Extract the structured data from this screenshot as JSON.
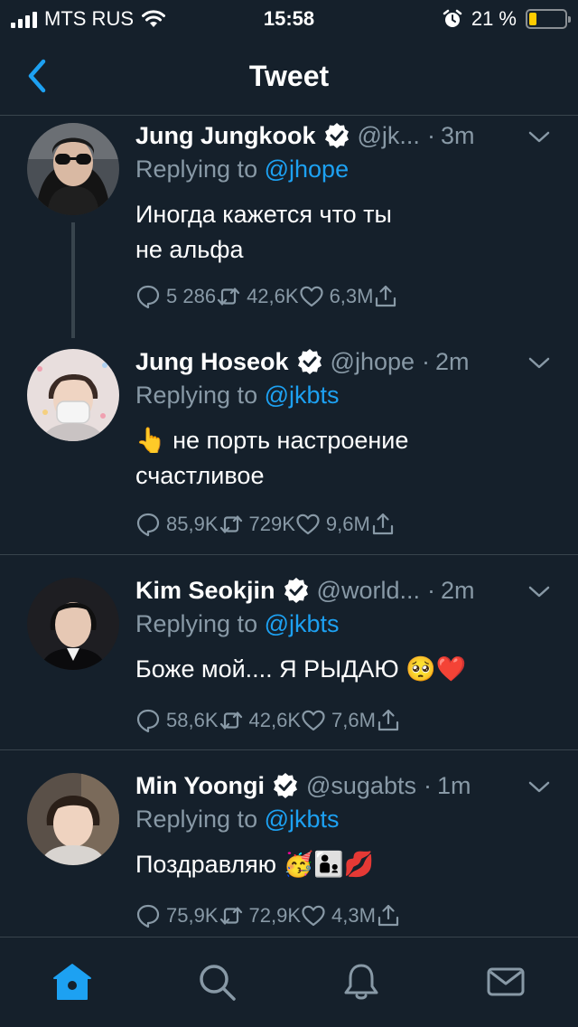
{
  "status_bar": {
    "carrier": "MTS RUS",
    "time": "15:58",
    "battery_percent": "21 %",
    "battery_level": 0.21
  },
  "nav": {
    "title": "Tweet"
  },
  "tweets": [
    {
      "name": "Jung Jungkook",
      "handle": "@jk...",
      "time": "3m",
      "replying_prefix": "Replying to",
      "replying_to": "@jhope",
      "text_lines": [
        "Иногда кажется что ты",
        "не альфа"
      ],
      "replies": "5 286",
      "retweets": "42,6K",
      "likes": "6,3M"
    },
    {
      "name": "Jung Hoseok",
      "handle": "@jhope",
      "time": "2m",
      "replying_prefix": "Replying to",
      "replying_to": "@jkbts",
      "text_lines": [
        "👆 не порть настроение",
        "счастливое"
      ],
      "replies": "85,9K",
      "retweets": "729K",
      "likes": "9,6M"
    },
    {
      "name": "Kim Seokjin",
      "handle": "@world...",
      "time": "2m",
      "replying_prefix": "Replying to",
      "replying_to": "@jkbts",
      "text_lines": [
        "Боже мой.... Я РЫДАЮ 🥺❤️"
      ],
      "replies": "58,6K",
      "retweets": "42,6K",
      "likes": "7,6M"
    },
    {
      "name": "Min Yoongi",
      "handle": "@sugabts",
      "time": "1m",
      "replying_prefix": "Replying to",
      "replying_to": "@jkbts",
      "text_lines": [
        "Поздравляю 🥳👨‍👦💋"
      ],
      "replies": "75,9K",
      "retweets": "72,9K",
      "likes": "4,3M"
    }
  ],
  "tab_bar": {
    "tabs": [
      "home-icon",
      "search-icon",
      "notifications-icon",
      "messages-icon"
    ],
    "active": "home-icon"
  },
  "colors": {
    "background": "#15202b",
    "accent": "#1da1f2",
    "secondary_text": "#8899a6",
    "separator": "#38444d",
    "battery": "#ffcc00"
  }
}
